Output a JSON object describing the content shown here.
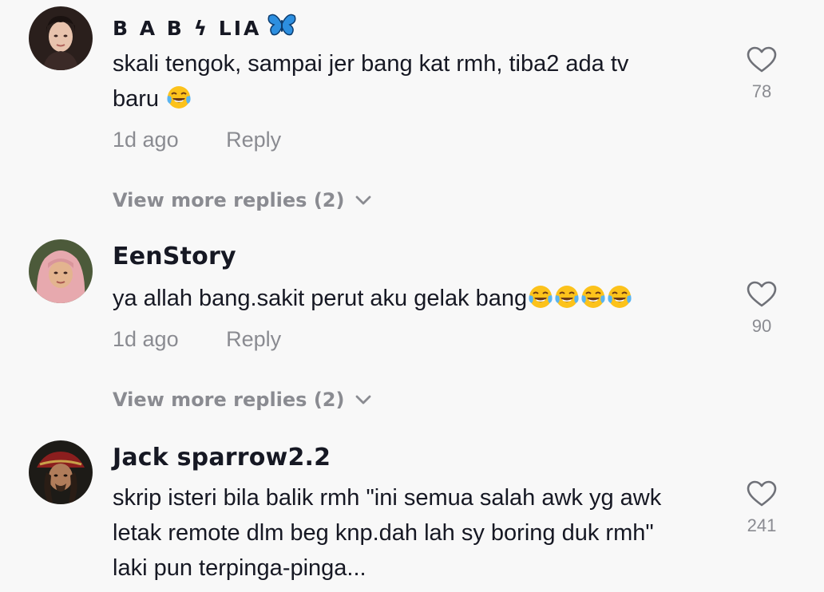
{
  "comments": [
    {
      "username": "B A B ϟ LIA",
      "text_line1": "skali tengok, sampai jer bang kat rmh, tiba2 ada tv",
      "text_line2": "baru",
      "time": "1d ago",
      "reply_label": "Reply",
      "more_replies": "View more replies (2)",
      "likes": "78"
    },
    {
      "username": "EenStory",
      "text_line1": "ya allah bang.sakit perut aku gelak bang",
      "time": "1d ago",
      "reply_label": "Reply",
      "more_replies": "View more replies (2)",
      "likes": "90"
    },
    {
      "username": "Jack sparrow2.2",
      "text_line1": "skrip isteri bila balik rmh \"ini semua salah awk yg awk",
      "text_line2": "letak remote dlm beg knp.dah lah sy boring duk rmh\"",
      "text_line3": "laki pun terpinga-pinga...",
      "likes": "241"
    }
  ],
  "icons": {
    "like": "heart-outline-icon",
    "expand": "chevron-down-icon",
    "emoji": "tears-of-joy-emoji",
    "decoration": "butterfly-emoji"
  },
  "colors": {
    "background": "#f8f8f8",
    "text": "#161823",
    "muted": "#8a8b91",
    "butterfly": "#2d8fe0"
  }
}
